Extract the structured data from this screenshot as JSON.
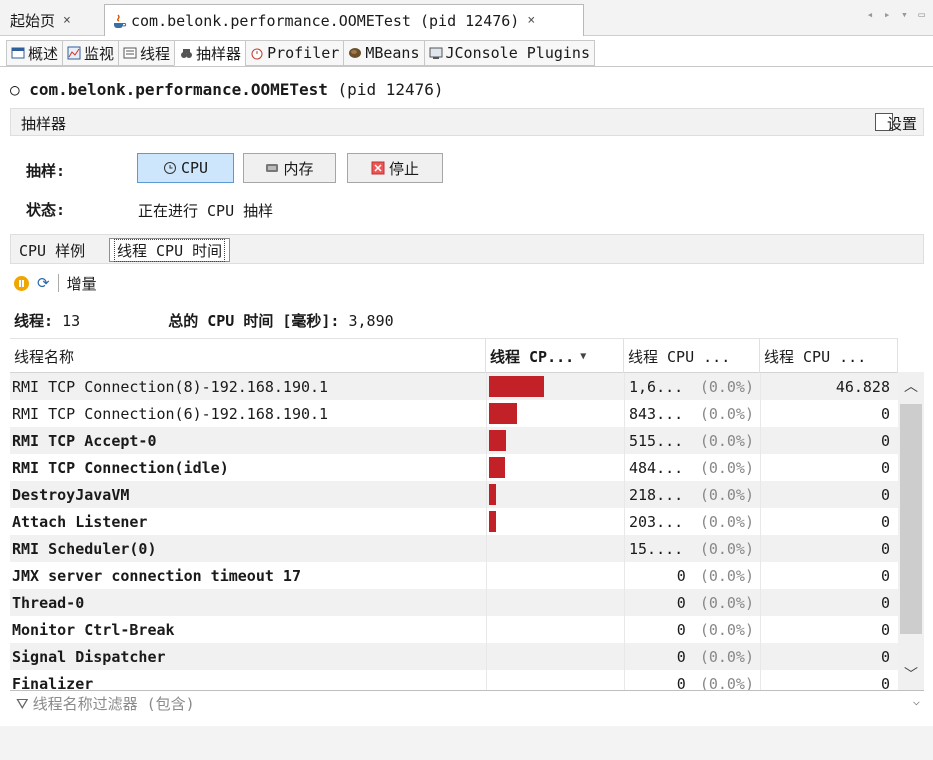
{
  "doc_tabs": {
    "home": "起始页",
    "app": "com.belonk.performance.OOMETest (pid 12476)",
    "close": "×"
  },
  "sub_tabs": [
    "概述",
    "监视",
    "线程",
    "抽样器",
    "Profiler",
    "MBeans",
    "JConsole Plugins"
  ],
  "title": {
    "name": "com.belonk.performance.OOMETest",
    "pid": "(pid 12476)"
  },
  "sampler": {
    "header": "抽样器",
    "settings": "设置"
  },
  "controls": {
    "sample_label": "抽样:",
    "cpu": "CPU",
    "memory": "内存",
    "stop": "停止",
    "status_label": "状态:",
    "status": "正在进行 CPU 抽样"
  },
  "view_tabs": {
    "samples": "CPU 样例",
    "thread_cpu": "线程 CPU 时间"
  },
  "toolbar": {
    "delta": "增量"
  },
  "summary": {
    "threads_label": "线程:",
    "threads": "13",
    "total_label": "总的 CPU 时间 [毫秒]:",
    "total": "3,890"
  },
  "table": {
    "headers": [
      "线程名称",
      "线程 CP...",
      "线程 CPU ...",
      "线程 CPU ..."
    ],
    "rows": [
      {
        "name": "RMI TCP Connection(8)-192.168.190.1",
        "bold": false,
        "share": 0.41,
        "time": "1,6...",
        "pct": "(0.0%)",
        "total": "46.828"
      },
      {
        "name": "RMI TCP Connection(6)-192.168.190.1",
        "bold": false,
        "share": 0.21,
        "time": "843...",
        "pct": "(0.0%)",
        "total": "0"
      },
      {
        "name": "RMI TCP Accept-0",
        "bold": true,
        "share": 0.13,
        "time": "515...",
        "pct": "(0.0%)",
        "total": "0"
      },
      {
        "name": "RMI TCP Connection(idle)",
        "bold": true,
        "share": 0.12,
        "time": "484...",
        "pct": "(0.0%)",
        "total": "0"
      },
      {
        "name": "DestroyJavaVM",
        "bold": true,
        "share": 0.055,
        "time": "218...",
        "pct": "(0.0%)",
        "total": "0"
      },
      {
        "name": "Attach Listener",
        "bold": true,
        "share": 0.052,
        "time": "203...",
        "pct": "(0.0%)",
        "total": "0"
      },
      {
        "name": "RMI Scheduler(0)",
        "bold": true,
        "share": 0.0,
        "time": "15....",
        "pct": "(0.0%)",
        "total": "0"
      },
      {
        "name": "JMX server connection timeout 17",
        "bold": true,
        "share": 0.0,
        "time": "0",
        "pct": "(0.0%)",
        "total": "0"
      },
      {
        "name": "Thread-0",
        "bold": true,
        "share": 0.0,
        "time": "0",
        "pct": "(0.0%)",
        "total": "0"
      },
      {
        "name": "Monitor Ctrl-Break",
        "bold": true,
        "share": 0.0,
        "time": "0",
        "pct": "(0.0%)",
        "total": "0"
      },
      {
        "name": "Signal Dispatcher",
        "bold": true,
        "share": 0.0,
        "time": "0",
        "pct": "(0.0%)",
        "total": "0"
      },
      {
        "name": "Finalizer",
        "bold": true,
        "share": 0.0,
        "time": "0",
        "pct": "(0.0%)",
        "total": "0"
      }
    ]
  },
  "filter": {
    "placeholder": "线程名称过滤器 (包含)"
  },
  "colors": {
    "bar": "#c22227",
    "cpu_button": "#cde6fb",
    "row_alt": "#f1f1f1"
  }
}
